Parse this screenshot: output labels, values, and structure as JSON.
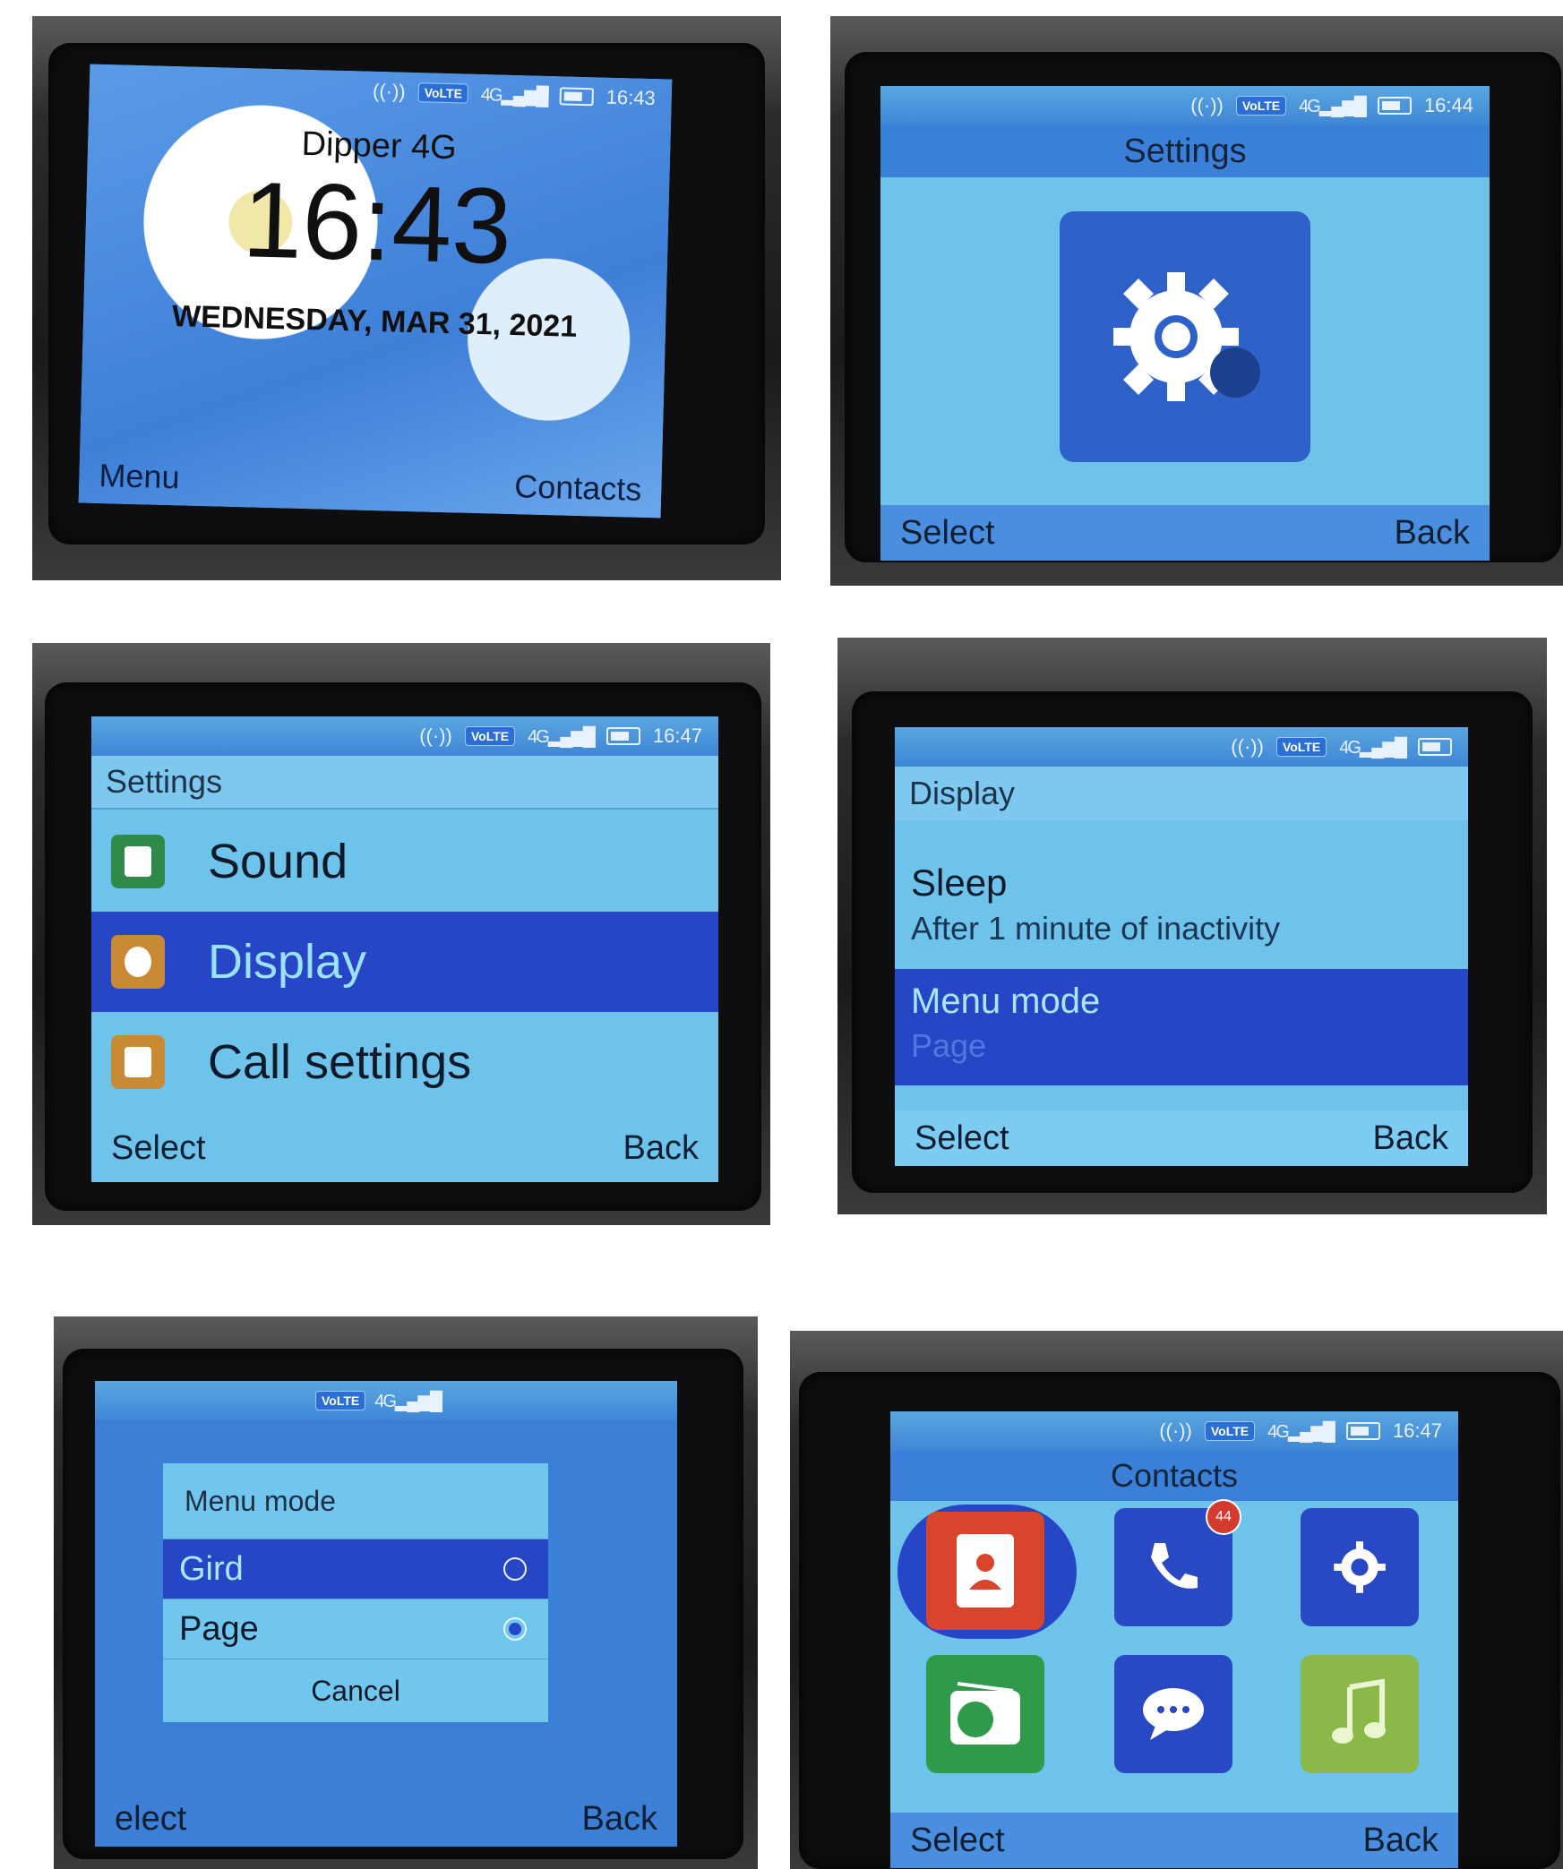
{
  "status": {
    "volte": "VoLTE",
    "network": "4G",
    "times": [
      "16:43",
      "16:44",
      "16:47",
      "16:47"
    ]
  },
  "home": {
    "carrier": "Dipper 4G",
    "clock": "16:43",
    "date": "WEDNESDAY, MAR 31, 2021",
    "left_softkey": "Menu",
    "right_softkey": "Contacts"
  },
  "settings_tile": {
    "title": "Settings",
    "left_softkey": "Select",
    "right_softkey": "Back",
    "icon": "gear-icon"
  },
  "settings_list": {
    "header": "Settings",
    "items": [
      {
        "label": "Sound",
        "icon": "sound-icon",
        "color": "#2f8a4a"
      },
      {
        "label": "Display",
        "icon": "display-icon",
        "color": "#c88a35"
      },
      {
        "label": "Call settings",
        "icon": "call-settings-icon",
        "color": "#c88a35"
      }
    ],
    "left_softkey": "Select",
    "right_softkey": "Back"
  },
  "display_list": {
    "header": "Display",
    "items": [
      {
        "title": "Sleep",
        "value": "After 1 minute of inactivity"
      },
      {
        "title": "Menu mode",
        "value": "Page"
      }
    ],
    "left_softkey": "Select",
    "right_softkey": "Back"
  },
  "menu_mode_dialog": {
    "title": "Menu mode",
    "options": [
      {
        "label": "Gird",
        "checked": false
      },
      {
        "label": "Page",
        "checked": true
      }
    ],
    "cancel": "Cancel",
    "left_softkey": "elect",
    "right_softkey": "Back"
  },
  "app_grid": {
    "title": "Contacts",
    "badge": "44",
    "apps": [
      {
        "name": "contacts-app",
        "icon": "contacts-book-icon",
        "color": "#d8452c"
      },
      {
        "name": "call-log-app",
        "icon": "phone-icon",
        "color": "#2848c4"
      },
      {
        "name": "settings-app",
        "icon": "gear-icon",
        "color": "#2848c4"
      },
      {
        "name": "radio-app",
        "icon": "radio-icon",
        "color": "#2e9a4a"
      },
      {
        "name": "messages-app",
        "icon": "message-bubble-icon",
        "color": "#2848c4"
      },
      {
        "name": "music-app",
        "icon": "music-note-icon",
        "color": "#8ab94a"
      }
    ],
    "left_softkey": "Select",
    "right_softkey": "Back"
  },
  "colors": {
    "screen": "#6ec3ea",
    "highlight": "#2746c6",
    "bar": "#3a80d8"
  }
}
